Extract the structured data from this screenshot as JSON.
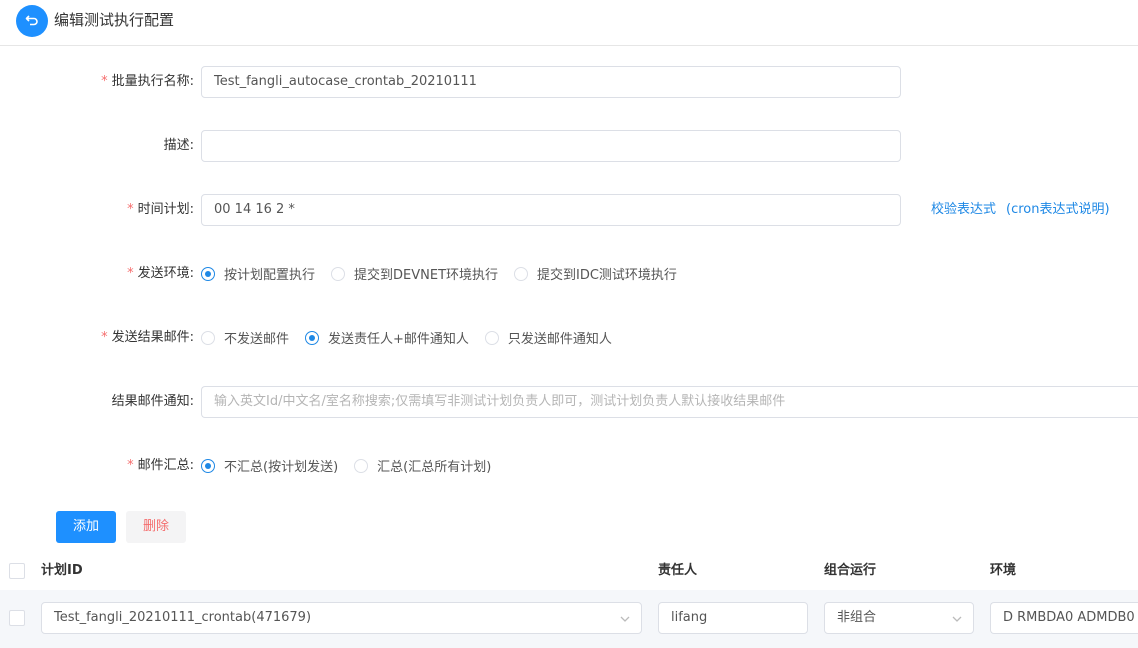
{
  "header": {
    "title": "编辑测试执行配置",
    "back_icon": "return-icon"
  },
  "form": {
    "batch_name": {
      "label": "批量执行名称:",
      "required": true,
      "value": "Test_fangli_autocase_crontab_20210111"
    },
    "description": {
      "label": "描述:",
      "required": false,
      "value": ""
    },
    "schedule": {
      "label": "时间计划:",
      "required": true,
      "value": "00 14 16 2 *",
      "validate_link": "校验表达式",
      "help_link": "(cron表达式说明)"
    },
    "send_env": {
      "label": "发送环境:",
      "required": true,
      "options": [
        "按计划配置执行",
        "提交到DEVNET环境执行",
        "提交到IDC测试环境执行"
      ],
      "selected": 0
    },
    "send_result_mail": {
      "label": "发送结果邮件:",
      "required": true,
      "options": [
        "不发送邮件",
        "发送责任人+邮件通知人",
        "只发送邮件通知人"
      ],
      "selected": 1
    },
    "result_mail_notify": {
      "label": "结果邮件通知:",
      "required": false,
      "placeholder": "输入英文Id/中文名/室名称搜索;仅需填写非测试计划负责人即可，测试计划负责人默认接收结果邮件"
    },
    "mail_summary": {
      "label": "邮件汇总:",
      "required": true,
      "options": [
        "不汇总(按计划发送)",
        "汇总(汇总所有计划)"
      ],
      "selected": 0
    }
  },
  "actions": {
    "add_label": "添加",
    "delete_label": "删除"
  },
  "table": {
    "columns": [
      "计划ID",
      "责任人",
      "组合运行",
      "环境"
    ],
    "rows": [
      {
        "plan_id": "Test_fangli_20210111_crontab(471679)",
        "owner": "lifang",
        "combined": "非组合",
        "env": "D RMBDA0 ADMDB0"
      }
    ]
  },
  "colors": {
    "primary": "#1e90ff",
    "danger": "#f56c6c",
    "link": "#1e88e5"
  }
}
